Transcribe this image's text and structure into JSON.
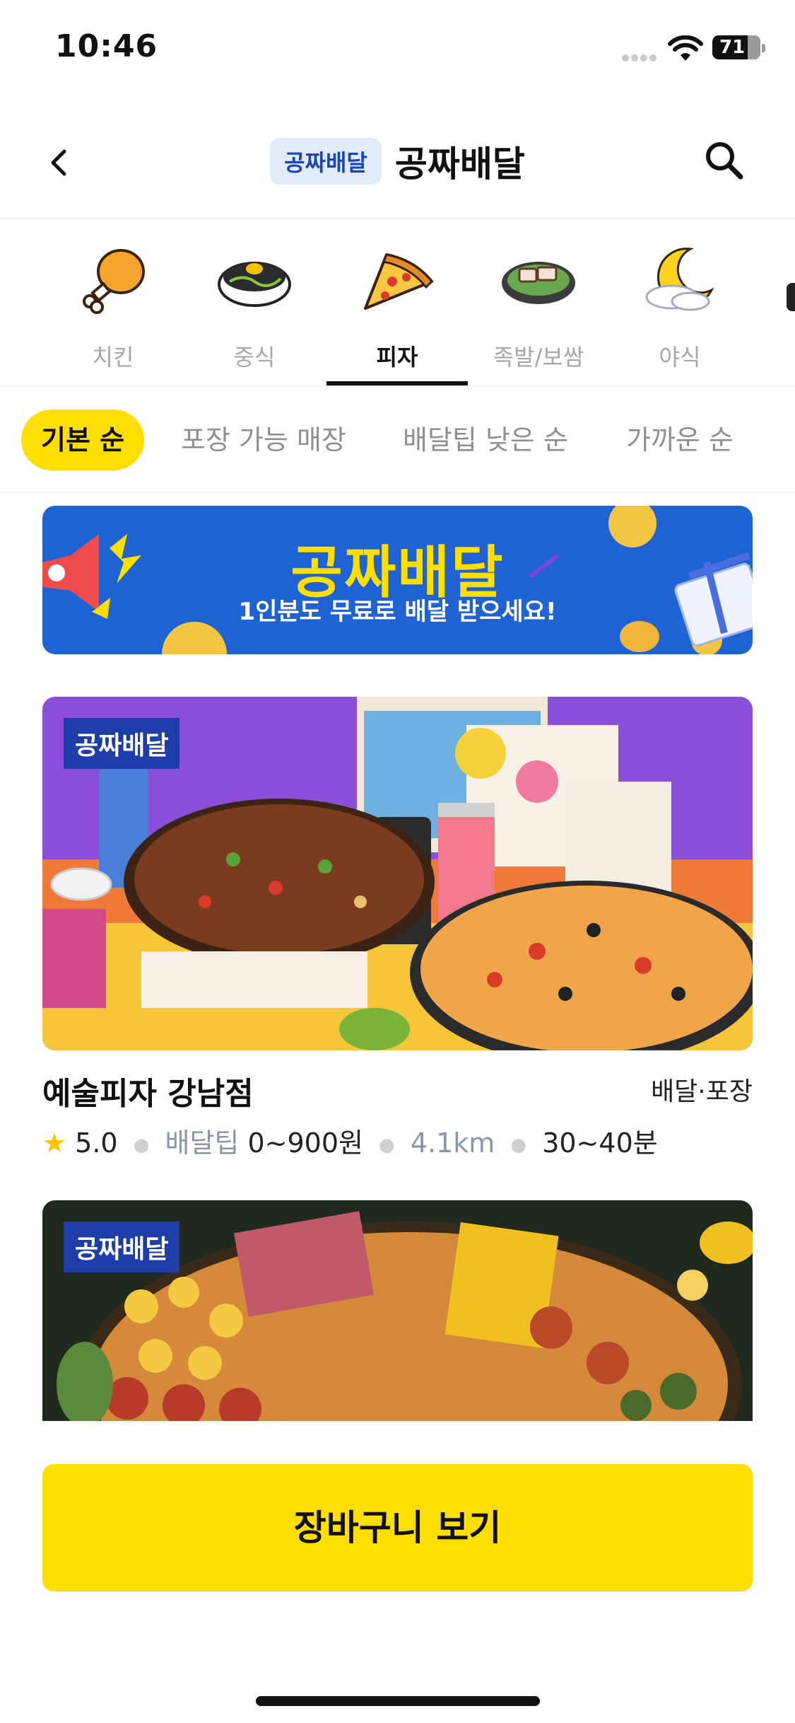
{
  "status_bar": {
    "time": "10:46",
    "battery": "71"
  },
  "header": {
    "badge": "공짜배달",
    "title": "공짜배달"
  },
  "categories": [
    {
      "label": "치킨",
      "icon": "chicken-icon"
    },
    {
      "label": "중식",
      "icon": "noodles-icon"
    },
    {
      "label": "피자",
      "icon": "pizza-icon",
      "active": true
    },
    {
      "label": "족발/보쌈",
      "icon": "bossam-icon"
    },
    {
      "label": "야식",
      "icon": "moon-icon"
    }
  ],
  "filters": [
    {
      "label": "기본 순",
      "active": true
    },
    {
      "label": "포장 가능 매장"
    },
    {
      "label": "배달팁 낮은 순"
    },
    {
      "label": "가까운 순"
    }
  ],
  "promo": {
    "title": "공짜배달",
    "subtitle": "1인분도 무료로 배달 받으세요!"
  },
  "stores": [
    {
      "badge": "공짜배달",
      "name": "예술피자 강남점",
      "service_type": "배달·포장",
      "rating": "5.0",
      "delivery_tip_label": "배달팁",
      "delivery_tip": "0~900원",
      "distance": "4.1km",
      "delivery_time": "30~40분"
    },
    {
      "badge": "공짜배달"
    }
  ],
  "cta": {
    "label": "장바구니 보기"
  },
  "colors": {
    "accent_yellow": "#ffde00",
    "brand_blue": "#1f63d2",
    "badge_navy": "#1f3da8"
  }
}
